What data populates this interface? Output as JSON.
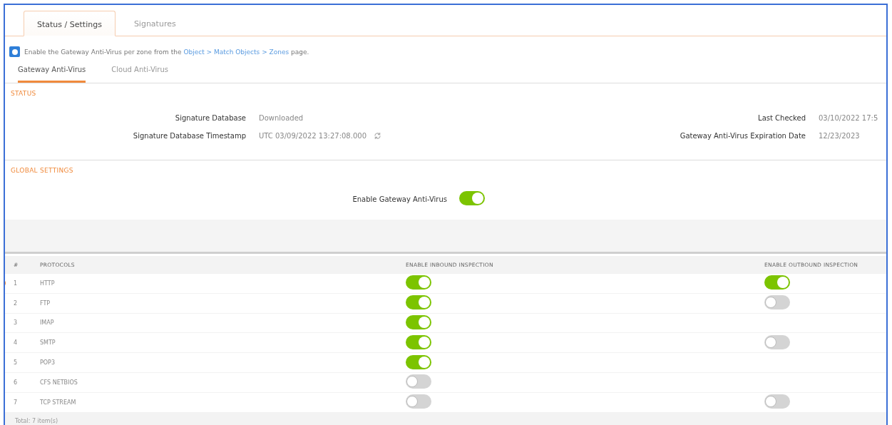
{
  "tabs": [
    {
      "label": "Status / Settings",
      "selected": true
    },
    {
      "label": "Signatures",
      "selected": false
    }
  ],
  "info": {
    "text": "Enable the Gateway Anti-Virus per zone from the",
    "link": "Object > Match Objects > Zones",
    "after": "page."
  },
  "subtabs": [
    {
      "label": "Gateway Anti-Virus",
      "selected": true
    },
    {
      "label": "Cloud Anti-Virus",
      "selected": false
    }
  ],
  "status": {
    "title": "STATUS",
    "fields": [
      {
        "label": "Signature Database",
        "value": "Downloaded"
      },
      {
        "label": "Last Checked",
        "value": "03/10/2022 17:5"
      },
      {
        "label": "Signature Database Timestamp",
        "value": "UTC 03/09/2022 13:27:08.000",
        "refresh": true
      },
      {
        "label": "Gateway Anti-Virus Expiration Date",
        "value": "12/23/2023"
      }
    ]
  },
  "global_settings": {
    "title": "GLOBAL SETTINGS",
    "label": "Enable Gateway Anti-Virus",
    "on": true
  },
  "table": {
    "columns": [
      "#",
      "PROTOCOLS",
      "ENABLE INBOUND INSPECTION",
      "ENABLE OUTBOUND INSPECTION"
    ],
    "rows": [
      {
        "index": "1",
        "protocol": "HTTP",
        "inbound": true,
        "outbound": true
      },
      {
        "index": "2",
        "protocol": "FTP",
        "inbound": true,
        "outbound": false
      },
      {
        "index": "3",
        "protocol": "IMAP",
        "inbound": true
      },
      {
        "index": "4",
        "protocol": "SMTP",
        "inbound": true,
        "outbound": false
      },
      {
        "index": "5",
        "protocol": "POP3",
        "inbound": true
      },
      {
        "index": "6",
        "protocol": "CFS NETBIOS",
        "inbound": false
      },
      {
        "index": "7",
        "protocol": "TCP STREAM",
        "inbound": false,
        "outbound": false
      }
    ],
    "footer": "Total: 7 item(s)"
  }
}
